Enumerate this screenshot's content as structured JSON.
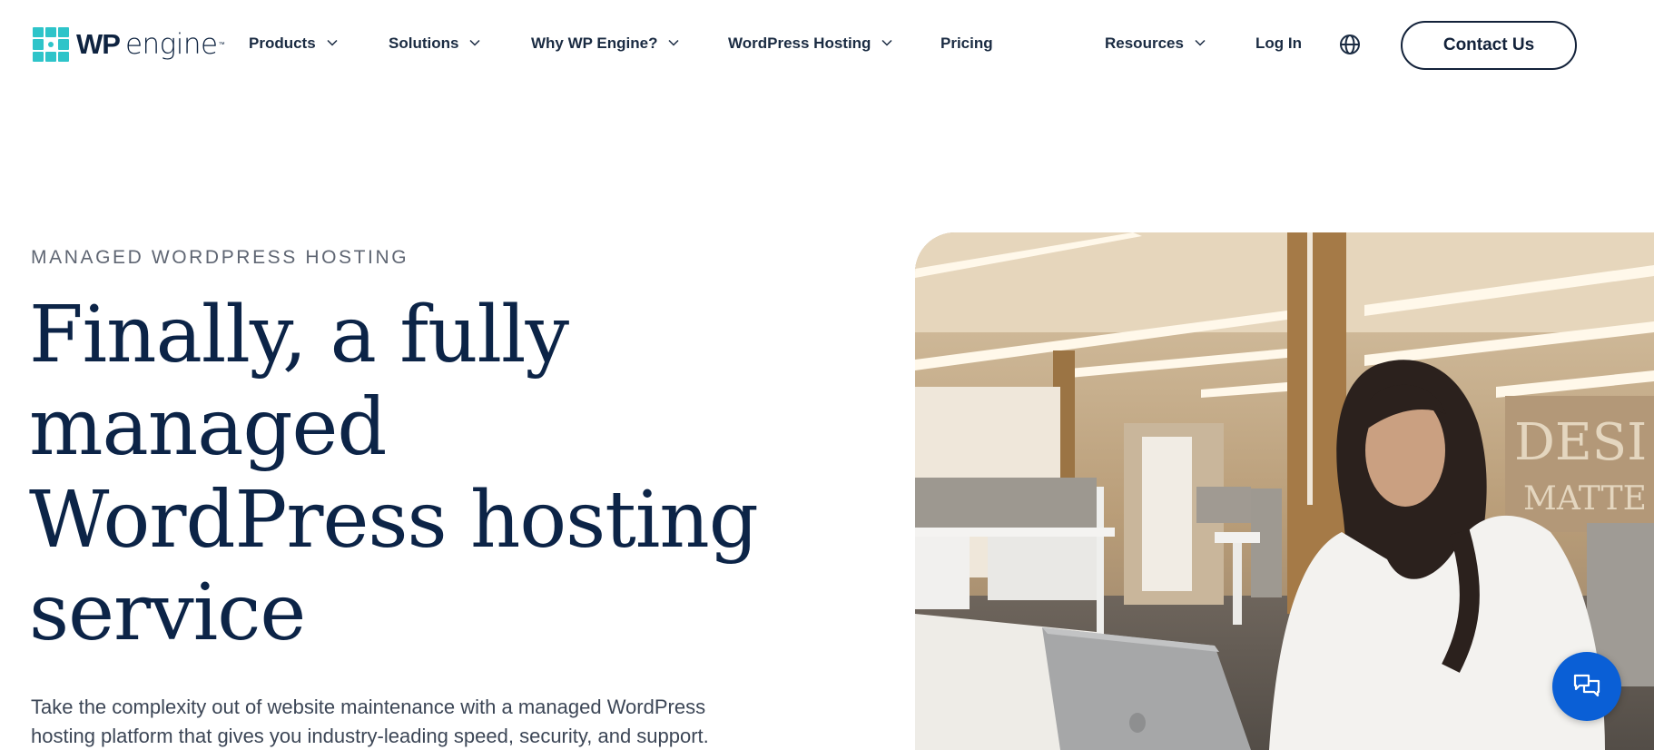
{
  "header": {
    "logo": {
      "wp": "WP",
      "engine": "engine",
      "tm": "™"
    },
    "nav": [
      {
        "label": "Products",
        "has_dropdown": true
      },
      {
        "label": "Solutions",
        "has_dropdown": true
      },
      {
        "label": "Why WP Engine?",
        "has_dropdown": true
      },
      {
        "label": "WordPress Hosting",
        "has_dropdown": true
      },
      {
        "label": "Pricing",
        "has_dropdown": false
      },
      {
        "label": "Resources",
        "has_dropdown": true
      },
      {
        "label": "Log In",
        "has_dropdown": false
      }
    ],
    "language_icon": "globe-icon",
    "contact_label": "Contact Us"
  },
  "hero": {
    "eyebrow": "MANAGED WORDPRESS HOSTING",
    "headline_lines": [
      "Finally, a fully",
      "managed",
      "WordPress hosting",
      "service"
    ],
    "lede_lines": [
      "Take the complexity out of website maintenance with a managed WordPress",
      "hosting platform that gives you industry-leading speed, security, and support."
    ],
    "image_alt": "Woman working on a laptop in an office"
  },
  "chat": {
    "icon": "chat-bubbles-icon"
  },
  "colors": {
    "brand_teal": "#2ec4c9",
    "navy": "#0c2447",
    "chat_blue": "#0a5fd6"
  }
}
